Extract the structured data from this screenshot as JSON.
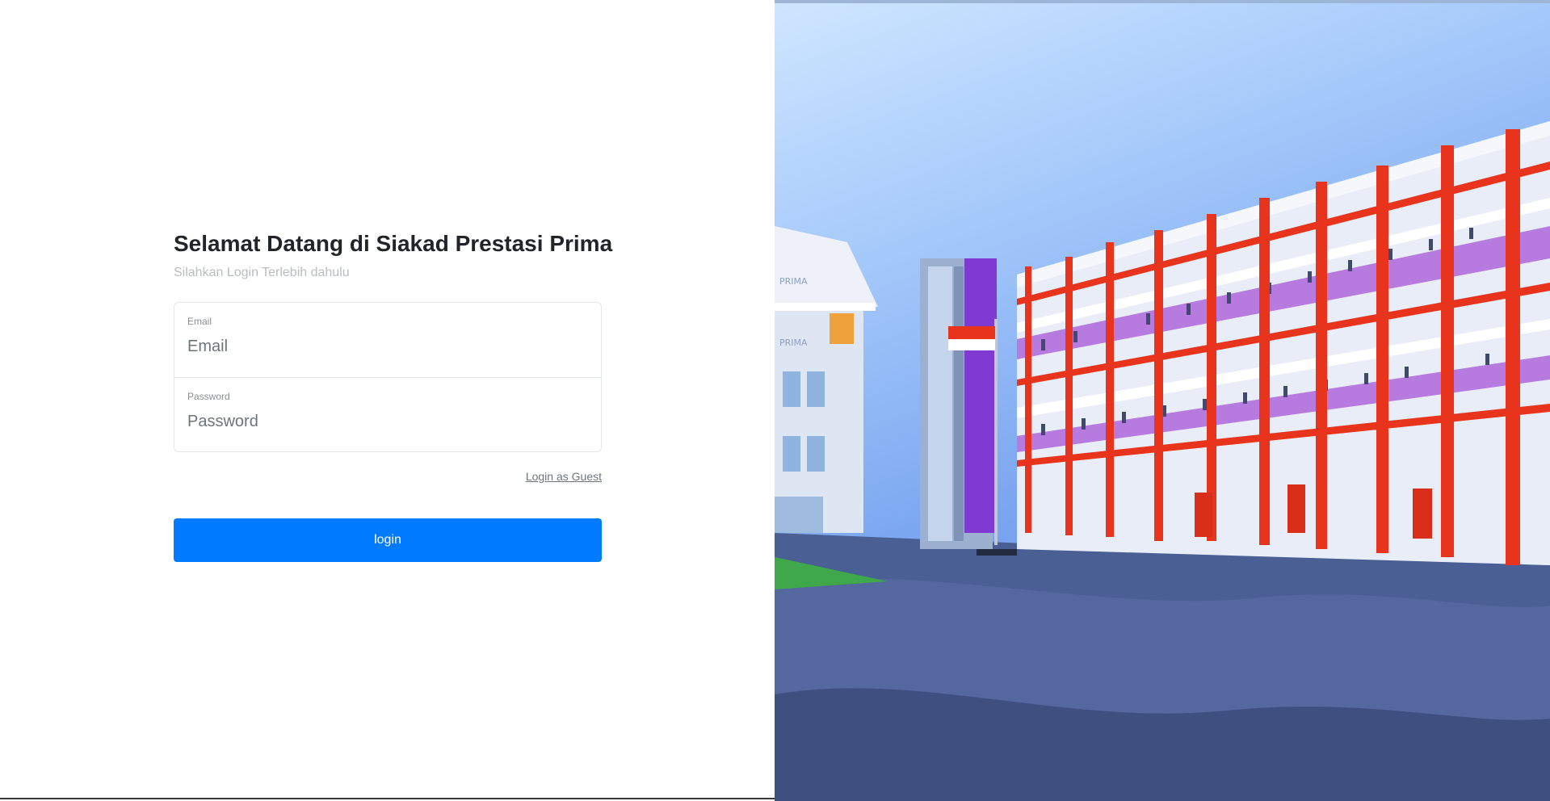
{
  "login": {
    "title_prefix": "Selamat Datang di ",
    "title_brand": "Siakad Prestasi Prima",
    "subtitle": "Silahkan Login Terlebih dahulu",
    "email_label": "Email",
    "email_placeholder": "Email",
    "password_label": "Password",
    "password_placeholder": "Password",
    "guest_link": "Login as Guest",
    "submit_label": "login"
  },
  "illustration": {
    "sign_text_1": "PRIMA",
    "sign_text_2": "PRIMA",
    "colors": {
      "accent": "#007bff",
      "building_red": "#e8341c",
      "building_purple": "#b77be0",
      "ground": "#4a5f93"
    }
  }
}
